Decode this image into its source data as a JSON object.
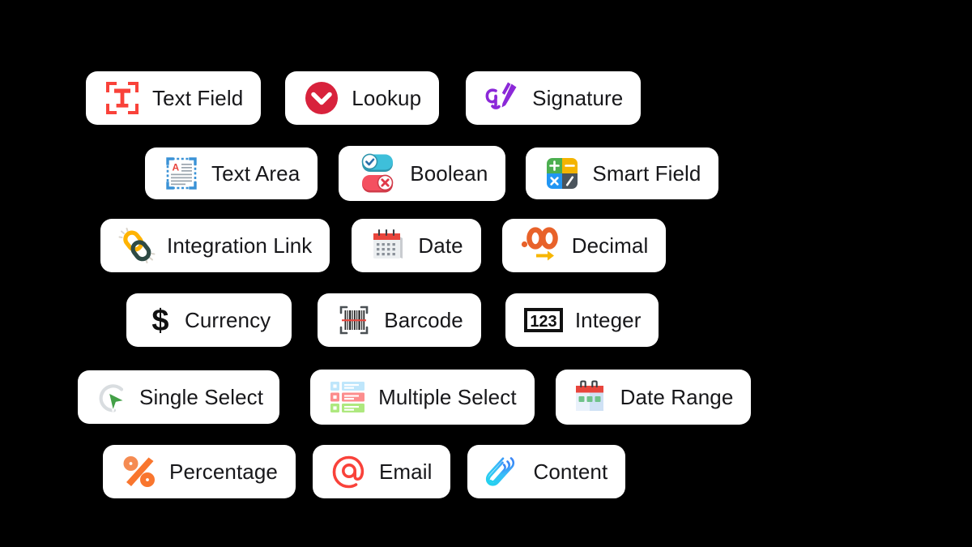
{
  "background_color": "#000000",
  "pill": {
    "background": "#ffffff",
    "text_color": "#17171a",
    "corner_radius_px": 14
  },
  "field_types": {
    "rows": [
      {
        "row_index": 1,
        "items": [
          {
            "label": "Text Field",
            "icon": "text-field-icon",
            "icon_colors": [
              "#f9423a"
            ]
          },
          {
            "label": "Lookup",
            "icon": "lookup-chevron-circle-icon",
            "icon_colors": [
              "#d8223c",
              "#ffffff"
            ]
          },
          {
            "label": "Signature",
            "icon": "signature-pen-icon",
            "icon_colors": [
              "#8b28d8"
            ]
          }
        ]
      },
      {
        "row_index": 2,
        "items": [
          {
            "label": "Text Area",
            "icon": "text-area-icon",
            "icon_colors": [
              "#3a92d6",
              "#e8443c",
              "#9aa4ad"
            ]
          },
          {
            "label": "Boolean",
            "icon": "boolean-toggle-icon",
            "icon_colors": [
              "#3ebfda",
              "#f45060",
              "#ffffff"
            ]
          },
          {
            "label": "Smart Field",
            "icon": "smart-field-calculator-icon",
            "icon_colors": [
              "#4caf50",
              "#f4b400",
              "#2196f3",
              "#4a545c"
            ]
          }
        ]
      },
      {
        "row_index": 3,
        "items": [
          {
            "label": "Integration Link",
            "icon": "integration-link-chain-icon",
            "icon_colors": [
              "#ffb300",
              "#2e4a45"
            ]
          },
          {
            "label": "Date",
            "icon": "calendar-icon",
            "icon_colors": [
              "#e8453c",
              "#eceff1",
              "#8a9199"
            ]
          },
          {
            "label": "Decimal",
            "icon": "decimal-zero-zero-icon",
            "icon_colors": [
              "#e8622a",
              "#f7b600"
            ]
          }
        ]
      },
      {
        "row_index": 4,
        "items": [
          {
            "label": "Currency",
            "icon": "dollar-sign-icon",
            "icon_colors": [
              "#111111"
            ]
          },
          {
            "label": "Barcode",
            "icon": "barcode-scan-icon",
            "icon_colors": [
              "#2b2b2b",
              "#e8453c"
            ]
          },
          {
            "label": "Integer",
            "icon": "integer-123-icon",
            "icon_colors": [
              "#111111"
            ]
          }
        ]
      },
      {
        "row_index": 5,
        "items": [
          {
            "label": "Single Select",
            "icon": "single-select-cursor-icon",
            "icon_colors": [
              "#d9dde0",
              "#43a047"
            ]
          },
          {
            "label": "Multiple Select",
            "icon": "multiple-select-list-icon",
            "icon_colors": [
              "#bfe6fb",
              "#fc8d8d",
              "#aee87f"
            ]
          },
          {
            "label": "Date Range",
            "icon": "date-range-calendar-icon",
            "icon_colors": [
              "#e8453c",
              "#dce9f7",
              "#6fc28a"
            ]
          }
        ]
      },
      {
        "row_index": 6,
        "items": [
          {
            "label": "Percentage",
            "icon": "percent-icon",
            "icon_colors": [
              "#f58b52",
              "#f9762e"
            ]
          },
          {
            "label": "Email",
            "icon": "at-sign-icon",
            "icon_colors": [
              "#f9423a"
            ]
          },
          {
            "label": "Content",
            "icon": "paperclip-icon",
            "icon_colors": [
              "#22d3ee",
              "#3b82f6"
            ]
          }
        ]
      }
    ]
  }
}
